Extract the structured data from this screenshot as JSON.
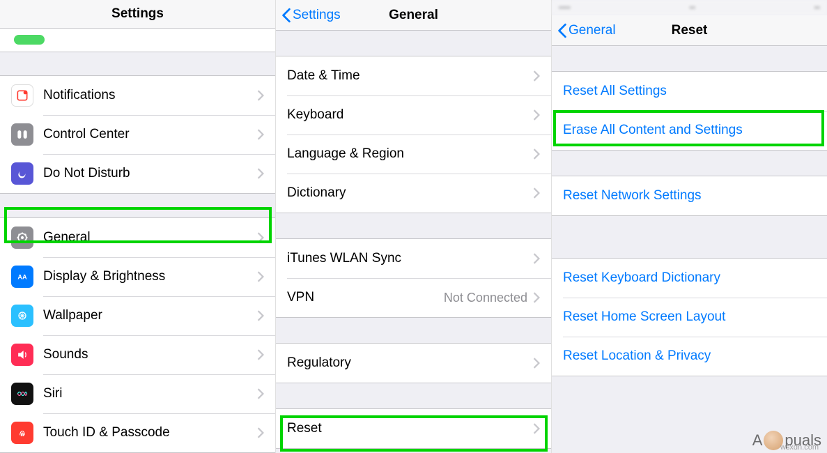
{
  "pane1": {
    "title": "Settings",
    "items_group1": [
      {
        "label": "Notifications",
        "icon": "notifications-icon",
        "color": "ic-white"
      },
      {
        "label": "Control Center",
        "icon": "control-center-icon",
        "color": "ic-gray"
      },
      {
        "label": "Do Not Disturb",
        "icon": "do-not-disturb-icon",
        "color": "ic-purple"
      }
    ],
    "items_group2": [
      {
        "label": "General",
        "icon": "general-icon",
        "color": "ic-gray"
      },
      {
        "label": "Display & Brightness",
        "icon": "display-brightness-icon",
        "color": "ic-blue"
      },
      {
        "label": "Wallpaper",
        "icon": "wallpaper-icon",
        "color": "ic-cyan"
      },
      {
        "label": "Sounds",
        "icon": "sounds-icon",
        "color": "ic-pink"
      },
      {
        "label": "Siri",
        "icon": "siri-icon",
        "color": "ic-black"
      },
      {
        "label": "Touch ID & Passcode",
        "icon": "touch-id-icon",
        "color": "ic-red"
      }
    ]
  },
  "pane2": {
    "back": "Settings",
    "title": "General",
    "group1": [
      {
        "label": "Date & Time"
      },
      {
        "label": "Keyboard"
      },
      {
        "label": "Language & Region"
      },
      {
        "label": "Dictionary"
      }
    ],
    "group2": [
      {
        "label": "iTunes WLAN Sync"
      },
      {
        "label": "VPN",
        "detail": "Not Connected"
      }
    ],
    "group3": [
      {
        "label": "Regulatory"
      }
    ],
    "group4": [
      {
        "label": "Reset"
      }
    ]
  },
  "pane3": {
    "back": "General",
    "title": "Reset",
    "group1": [
      {
        "label": "Reset All Settings"
      },
      {
        "label": "Erase All Content and Settings"
      }
    ],
    "group2": [
      {
        "label": "Reset Network Settings"
      }
    ],
    "group3": [
      {
        "label": "Reset Keyboard Dictionary"
      },
      {
        "label": "Reset Home Screen Layout"
      },
      {
        "label": "Reset Location & Privacy"
      }
    ]
  },
  "watermark": {
    "prefix": "A",
    "suffix": "puals",
    "domain": "wsxdn.com"
  }
}
